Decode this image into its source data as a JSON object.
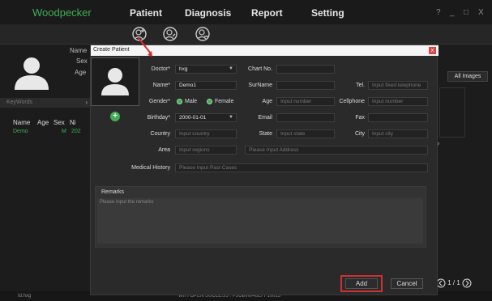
{
  "app": {
    "logo": "Woodpecker"
  },
  "nav": {
    "tabs": [
      {
        "label": "Patient"
      },
      {
        "label": "Diagnosis"
      },
      {
        "label": "Report"
      },
      {
        "label": "Setting"
      }
    ],
    "window_controls": [
      "?",
      "_",
      "□",
      "X"
    ]
  },
  "toolbar": {
    "icons": [
      "add-patient-icon",
      "edit-patient-icon",
      "delete-patient-icon"
    ]
  },
  "left_panel": {
    "labels": [
      "Name",
      "Sex",
      "Age"
    ],
    "keywords_placeholder": "KeyWords",
    "list_headers": [
      "Name",
      "Age",
      "Sex",
      "Ni"
    ],
    "rows": [
      {
        "name": "Demo",
        "age": "",
        "sex": "M",
        "extra": "202"
      }
    ]
  },
  "right_panel": {
    "filter": "All Images",
    "pager": "1 / 1",
    "question": "?"
  },
  "dialog": {
    "title": "Create Patient",
    "close": "x",
    "fields": {
      "doctor_label": "Doctor*",
      "doctor_value": "hxg",
      "chart_label": "Chart No.",
      "chart_value": "",
      "name_label": "Name*",
      "name_value": "Demo1",
      "surname_label": "SurName",
      "surname_value": "",
      "tel_label": "Tel.",
      "tel_placeholder": "Input fixed telephone",
      "gender_label": "Gender*",
      "gender_male": "Male",
      "gender_female": "Female",
      "gender_selected": "Female",
      "age_label": "Age",
      "age_placeholder": "Input number",
      "cell_label": "Cellphone",
      "cell_placeholder": "Input number",
      "birthday_label": "Birthday*",
      "birthday_value": "2000-01-01",
      "email_label": "Email",
      "email_value": "",
      "fax_label": "Fax",
      "fax_value": "",
      "country_label": "Country",
      "country_placeholder": "Input country",
      "state_label": "State",
      "state_placeholder": "Input state",
      "city_label": "City",
      "city_placeholder": "Input city",
      "area_label": "Area",
      "area_placeholder": "Input regions",
      "address_placeholder": "Please Input Address",
      "history_label": "Medical History",
      "history_placeholder": "Please Input Past Cases"
    },
    "remarks_label": "Remarks",
    "remarks_placeholder": "Please input the remarks",
    "add_button": "Add",
    "cancel_button": "Cancel"
  },
  "status": {
    "left": "Id.hxg",
    "center": "WIFI OPEN SUCCESS : i-Scan/W46EFF10015"
  },
  "colors": {
    "accent": "#3fae55",
    "highlight": "#d03030"
  }
}
